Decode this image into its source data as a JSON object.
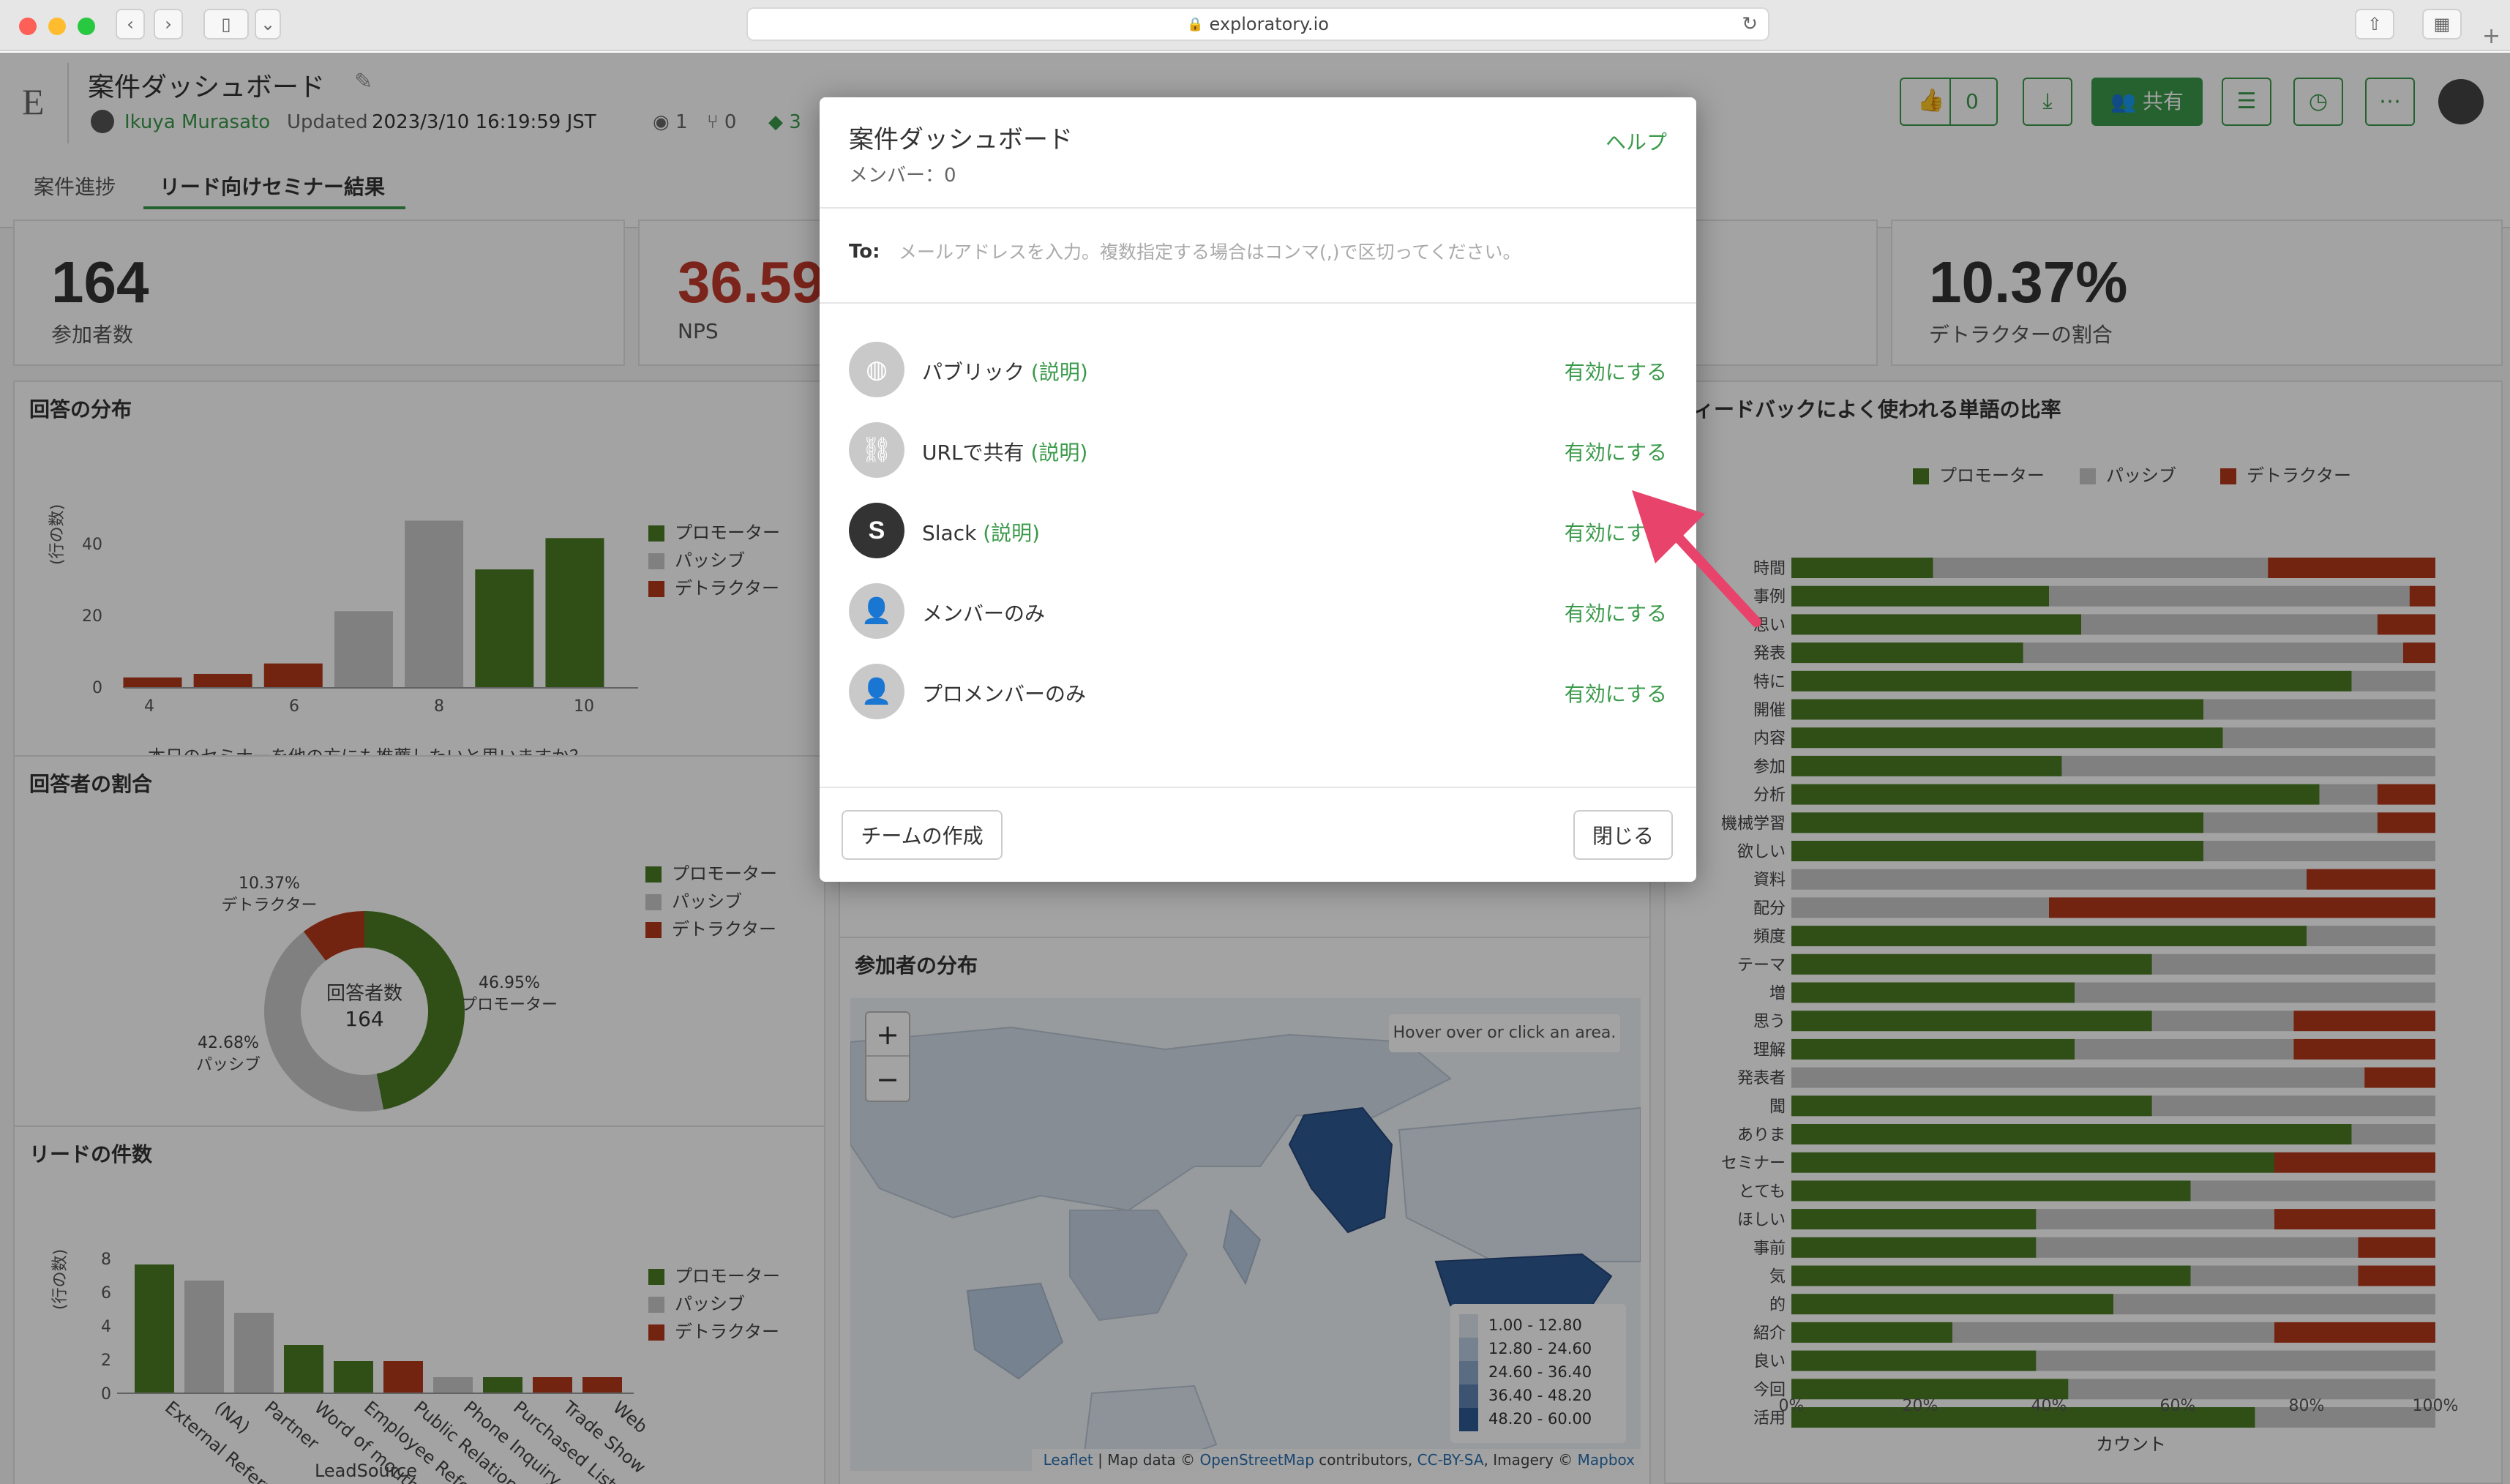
{
  "browser": {
    "url": "exploratory.io"
  },
  "header": {
    "logo": "E",
    "title": "案件ダッシュボード",
    "author": "Ikuya Murasato",
    "updated_label": "Updated",
    "updated_time": "2023/3/10 16:19:59 JST",
    "views": "1",
    "forks": "0",
    "tags": "3",
    "likes": "0",
    "share_label": "共有"
  },
  "tabs": [
    "案件進捗",
    "リード向けセミナー結果"
  ],
  "kpis": [
    {
      "value": "164",
      "label": "参加者数"
    },
    {
      "value": "36.59",
      "label": "NPS"
    },
    {
      "value": "10.37%",
      "label": "デトラクターの割合"
    }
  ],
  "legend": {
    "promoter": "プロモーター",
    "passive": "パッシブ",
    "detractor": "デトラクター"
  },
  "colors": {
    "promoter": "#4a7c25",
    "passive": "#c9c9c9",
    "detractor": "#b5391b",
    "accent": "#3a9a4a",
    "arrow": "#e8436b"
  },
  "sections": {
    "answer_dist": "回答の分布",
    "ratio": "回答者の割合",
    "leads": "リードの件数",
    "participants_map": "参加者の分布",
    "words": "ィードバックによく使われる単語の比率"
  },
  "chart_data": [
    {
      "type": "bar",
      "title": "回答の分布",
      "xlabel": "本日のセミナーを他の方にも推薦したいと思いますか？",
      "ylabel": "(行の数)",
      "x": [
        4,
        5,
        6,
        7,
        8,
        9,
        10
      ],
      "values": [
        3,
        4,
        7,
        22,
        48,
        34,
        43
      ],
      "group": [
        "detractor",
        "detractor",
        "detractor",
        "passive",
        "passive",
        "promoter",
        "promoter"
      ],
      "xticks": [
        "4",
        "6",
        "8",
        "10"
      ],
      "yticks": [
        "0",
        "20",
        "40"
      ],
      "ylim": [
        0,
        50
      ]
    },
    {
      "type": "pie",
      "title": "回答者の割合",
      "center_label": "回答者数",
      "center_value": "164",
      "slices": [
        {
          "name": "プロモーター",
          "value": 46.95,
          "label": "46.95%"
        },
        {
          "name": "パッシブ",
          "value": 42.68,
          "label": "42.68%"
        },
        {
          "name": "デトラクター",
          "value": 10.37,
          "label": "10.37%"
        }
      ]
    },
    {
      "type": "bar",
      "title": "リードの件数",
      "xlabel": "LeadSource",
      "ylabel": "(行の数)",
      "categories": [
        "External Referral",
        "(NA)",
        "Partner",
        "Word of mouth",
        "Employee Referral",
        "Public Relations",
        "Phone Inquiry",
        "Purchased List",
        "Trade Show",
        "Web"
      ],
      "values": [
        8,
        7,
        5,
        3,
        2,
        2,
        1,
        1,
        1,
        1
      ],
      "group": [
        "promoter",
        "passive",
        "passive",
        "promoter",
        "promoter",
        "detractor",
        "passive",
        "promoter",
        "detractor",
        "detractor"
      ],
      "yticks": [
        "0",
        "2",
        "4",
        "6",
        "8"
      ],
      "ylim": [
        0,
        8
      ]
    },
    {
      "type": "bar",
      "title": "ィードバックによく使われる単語の比率",
      "xlabel": "カウント",
      "xticks": [
        "0%",
        "20%",
        "40%",
        "60%",
        "80%",
        "100%"
      ],
      "categories": [
        "時間",
        "事例",
        "思い",
        "発表",
        "特に",
        "開催",
        "内容",
        "参加",
        "分析",
        "機械学習",
        "欲しい",
        "資料",
        "配分",
        "頻度",
        "テーマ",
        "増",
        "思う",
        "理解",
        "発表者",
        "聞",
        "ありま",
        "セミナー",
        "とても",
        "ほしい",
        "事前",
        "気",
        "的",
        "紹介",
        "良い",
        "今回",
        "活用"
      ],
      "series": [
        {
          "name": "プロモーター",
          "values": [
            22,
            40,
            45,
            36,
            87,
            64,
            67,
            42,
            82,
            64,
            64,
            0,
            0,
            80,
            56,
            44,
            56,
            44,
            0,
            56,
            87,
            75,
            62,
            38,
            38,
            62,
            50,
            25,
            38,
            43,
            72
          ]
        },
        {
          "name": "パッシブ",
          "values": [
            52,
            56,
            46,
            59,
            13,
            36,
            33,
            58,
            9,
            27,
            36,
            80,
            40,
            20,
            44,
            56,
            22,
            34,
            89,
            44,
            13,
            0,
            38,
            37,
            50,
            26,
            50,
            50,
            62,
            57,
            28
          ]
        },
        {
          "name": "デトラクター",
          "values": [
            26,
            4,
            9,
            5,
            0,
            0,
            0,
            0,
            9,
            9,
            0,
            20,
            60,
            0,
            0,
            0,
            22,
            22,
            11,
            0,
            0,
            25,
            0,
            25,
            12,
            12,
            0,
            25,
            0,
            0,
            0
          ]
        }
      ]
    }
  ],
  "map": {
    "zoom_in": "+",
    "zoom_out": "−",
    "hover_hint": "Hover over or click an area.",
    "legend": [
      "1.00 - 12.80",
      "12.80 - 24.60",
      "24.60 - 36.40",
      "36.40 - 48.20",
      "48.20 - 60.00"
    ],
    "legend_colors": [
      "#dde6f0",
      "#b9cce0",
      "#8eaacb",
      "#5f84b3",
      "#2f5a94"
    ],
    "attribution": [
      "Leaflet",
      " | Map data © ",
      "OpenStreetMap",
      " contributors, ",
      "CC-BY-SA",
      ", Imagery © ",
      "Mapbox"
    ]
  },
  "modal": {
    "title": "案件ダッシュボード",
    "help": "ヘルプ",
    "members": "メンバー：0",
    "to_label": "To:",
    "to_placeholder": "メールアドレスを入力。複数指定する場合はコンマ(,)で区切ってください。",
    "options": [
      {
        "label": "パブリック",
        "explain": "(説明)",
        "action": "有効にする",
        "icon": "globe-icon"
      },
      {
        "label": "URLで共有",
        "explain": "(説明)",
        "action": "有効にする",
        "icon": "link-icon"
      },
      {
        "label": "Slack",
        "explain": "(説明)",
        "action": "有効にする",
        "icon": "slack-icon"
      },
      {
        "label": "メンバーのみ",
        "explain": "",
        "action": "有効にする",
        "icon": "member-lock-icon"
      },
      {
        "label": "プロメンバーのみ",
        "explain": "",
        "action": "有効にする",
        "icon": "pro-member-lock-icon"
      }
    ],
    "create_team": "チームの作成",
    "close": "閉じる"
  }
}
